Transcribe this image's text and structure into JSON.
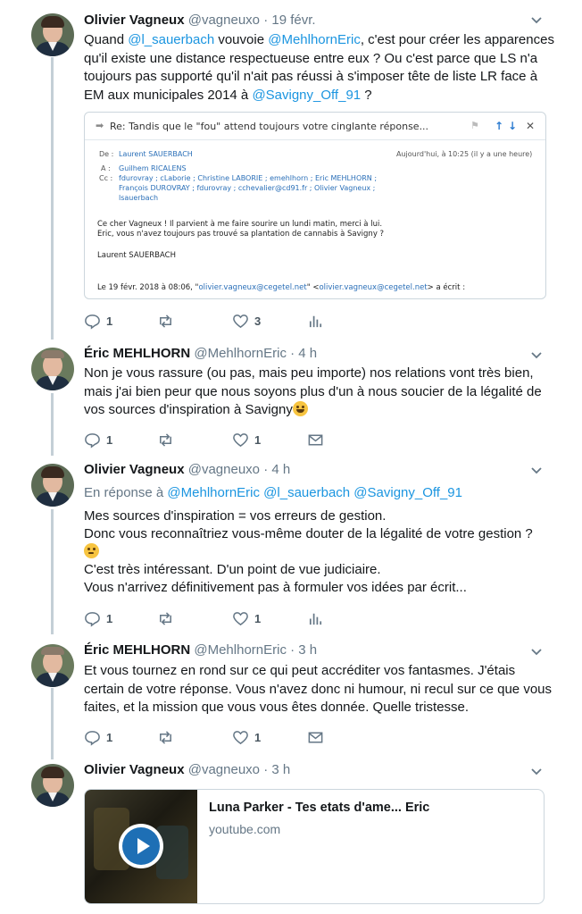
{
  "tweets": [
    {
      "name": "Olivier Vagneux",
      "handle": "@vagneuxo",
      "time": "19 févr.",
      "text_parts": [
        "Quand ",
        "@l_sauerbach",
        " vouvoie ",
        "@MehlhornEric",
        ", c'est pour créer les apparences qu'il existe une distance respectueuse entre eux ? Ou c'est parce que LS n'a toujours pas supporté qu'il n'ait pas réussi à s'imposer tête de liste LR face à EM aux municipales 2014 à ",
        "@Savigny_Off_91",
        " ?"
      ],
      "replies": "1",
      "retweets": "",
      "likes": "3"
    },
    {
      "name": "Éric MEHLHORN",
      "handle": "@MehlhornEric",
      "time": "4 h",
      "text": "Non je vous rassure (ou pas, mais peu importe) nos relations vont très bien, mais j'ai bien peur que nous soyons plus d'un à nous soucier de la légalité de vos sources d'inspiration à Savigny",
      "replies": "1",
      "retweets": "",
      "likes": "1"
    },
    {
      "name": "Olivier Vagneux",
      "handle": "@vagneuxo",
      "time": "4 h",
      "reply_prefix": "En réponse à",
      "reply_to": [
        "@MehlhornEric",
        "@l_sauerbach",
        "@Savigny_Off_91"
      ],
      "lines": [
        "Mes sources d'inspiration = vos erreurs de gestion.",
        "Donc vous reconnaîtriez vous-même douter de la légalité de votre gestion ?",
        "C'est très intéressant. D'un point de vue judiciaire.",
        "Vous n'arrivez définitivement pas à formuler vos idées par écrit..."
      ],
      "replies": "1",
      "retweets": "",
      "likes": "1"
    },
    {
      "name": "Éric MEHLHORN",
      "handle": "@MehlhornEric",
      "time": "3 h",
      "text": "Et vous tournez en rond sur ce qui peut accréditer vos fantasmes. J'étais certain de votre réponse. Vous n'avez donc ni humour, ni recul sur ce que vous faites, et la mission que vous vous êtes donnée. Quelle tristesse.",
      "replies": "1",
      "retweets": "",
      "likes": "1"
    },
    {
      "name": "Olivier Vagneux",
      "handle": "@vagneuxo",
      "time": "3 h"
    }
  ],
  "email": {
    "subject": "Re: Tandis que le \"fou\" attend toujours votre cinglante réponse...",
    "de_label": "De :",
    "de_value": "Laurent SAUERBACH",
    "date": "Aujourd'hui, à 10:25 (il y a une heure)",
    "a_label": "A :",
    "a_value": "Guilhem RICALENS",
    "cc_label": "Cc :",
    "cc_line1": "fdurovray ; cLaborie ; Christine LABORIE ; emehlhorn ; Eric MEHLHORN ;",
    "cc_line2": "François DUROVRAY ; fdurovray ; cchevalier@cd91.fr ; Olivier Vagneux ;",
    "cc_line3": "lsauerbach",
    "body1": "Ce cher Vagneux ! Il parvient à me faire sourire un lundi matin, merci à lui.",
    "body2": "Eric, vous n'avez toujours pas trouvé sa plantation de cannabis à Savigny ?",
    "signature": "Laurent SAUERBACH",
    "quote_prefix": "Le 19 févr. 2018 à 08:06, \"",
    "quote_email1": "olivier.vagneux@cegetel.net",
    "quote_mid": "\" <",
    "quote_email2": "olivier.vagneux@cegetel.net",
    "quote_suffix": "> a écrit :"
  },
  "card": {
    "title": "Luna Parker - Tes etats d'ame... Eric",
    "domain": "youtube.com"
  },
  "colors": {
    "link": "#1b95e0",
    "muted": "#657786",
    "thread": "#c4cfd6"
  }
}
